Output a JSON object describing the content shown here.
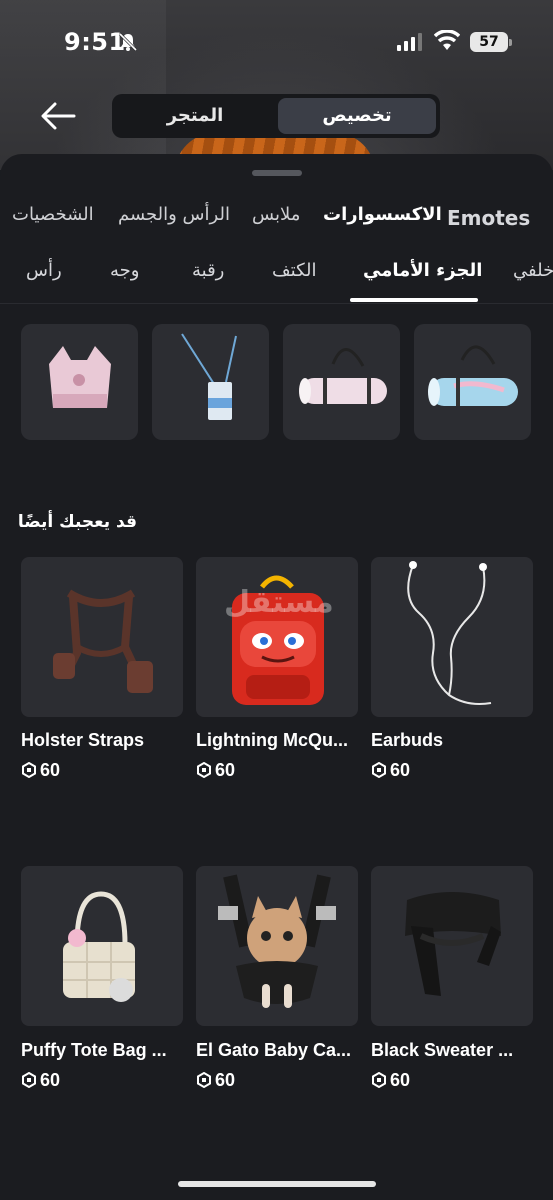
{
  "status": {
    "time": "9:51",
    "battery": "57"
  },
  "header": {
    "tabs": [
      "تخصيص",
      "المتجر"
    ],
    "active_tab": "تخصيص"
  },
  "categories": [
    "Emotes",
    "الاكسسوارات",
    "ملابس",
    "الرأس والجسم",
    "الشخصيات"
  ],
  "active_category": "الاكسسوارات",
  "subcategories": [
    "خلفي",
    "الجزء الأمامي",
    "الكتف",
    "رقبة",
    "وجه",
    "رأس"
  ],
  "active_subcategory": "الجزء الأمامي",
  "section_title": "قد يعجبك أيضًا",
  "items": [
    {
      "name": "Holster Straps",
      "price": "60"
    },
    {
      "name": "Lightning McQu...",
      "price": "60"
    },
    {
      "name": "Earbuds",
      "price": "60"
    },
    {
      "name": "Puffy Tote Bag ...",
      "price": "60"
    },
    {
      "name": "El Gato Baby Ca...",
      "price": "60"
    },
    {
      "name": "Black Sweater ...",
      "price": "60"
    }
  ],
  "watermark": "مستقل",
  "colors": {
    "background": "#1b1c20",
    "card": "#2c2d32",
    "active_tab": "#3b3e47"
  }
}
